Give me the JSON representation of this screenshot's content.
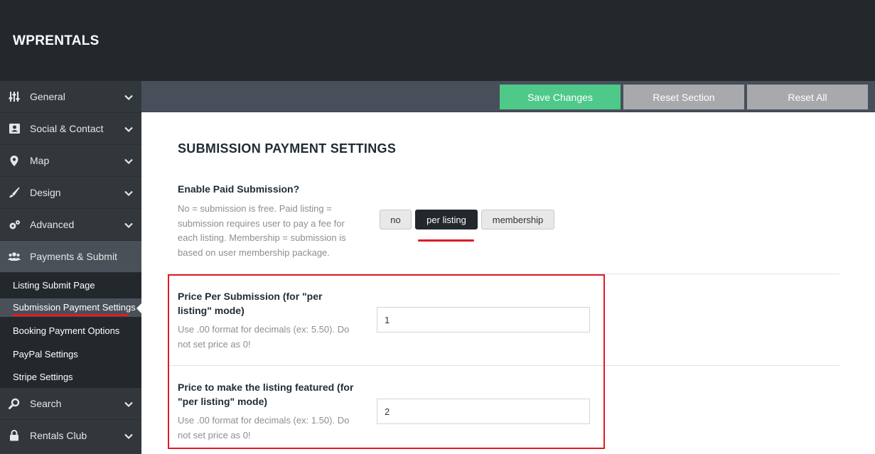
{
  "header": {
    "brand": "WPRENTALS"
  },
  "sidebar": {
    "items": [
      {
        "label": "General",
        "icon": "sliders-icon"
      },
      {
        "label": "Social & Contact",
        "icon": "contact-card-icon"
      },
      {
        "label": "Map",
        "icon": "map-pin-icon"
      },
      {
        "label": "Design",
        "icon": "brush-icon"
      },
      {
        "label": "Advanced",
        "icon": "gears-icon"
      },
      {
        "label": "Payments & Submit",
        "icon": "users-icon",
        "active": true
      },
      {
        "label": "Search",
        "icon": "search-icon"
      },
      {
        "label": "Rentals Club",
        "icon": "lock-icon"
      }
    ],
    "submenu": [
      {
        "label": "Listing Submit Page"
      },
      {
        "label": "Submission Payment Settings",
        "current": true
      },
      {
        "label": "Booking Payment Options"
      },
      {
        "label": "PayPal Settings"
      },
      {
        "label": "Stripe Settings"
      }
    ]
  },
  "toolbar": {
    "save_label": "Save Changes",
    "reset_section_label": "Reset Section",
    "reset_all_label": "Reset All"
  },
  "main": {
    "section_title": "SUBMISSION PAYMENT SETTINGS",
    "enable_paid": {
      "title": "Enable Paid Submission?",
      "description": "No = submission is free. Paid listing = submission requires user to pay a fee for each listing. Membership = submission is based on user membership package.",
      "options": [
        "no",
        "per listing",
        "membership"
      ],
      "selected": "per listing"
    },
    "price_per_submission": {
      "title": "Price Per Submission (for \"per listing\" mode)",
      "description": "Use .00 format for decimals (ex: 5.50). Do not set price as 0!",
      "value": "1"
    },
    "price_featured": {
      "title": "Price to make the listing featured (for \"per listing\" mode)",
      "description": "Use .00 format for decimals (ex: 1.50). Do not set price as 0!",
      "value": "2"
    }
  },
  "colors": {
    "header_bg": "#23282d",
    "sidebar_bg": "#32373c",
    "save_green": "#4ec98a",
    "reset_gray": "#a7a9ad",
    "annotation_red": "#e01b24"
  }
}
